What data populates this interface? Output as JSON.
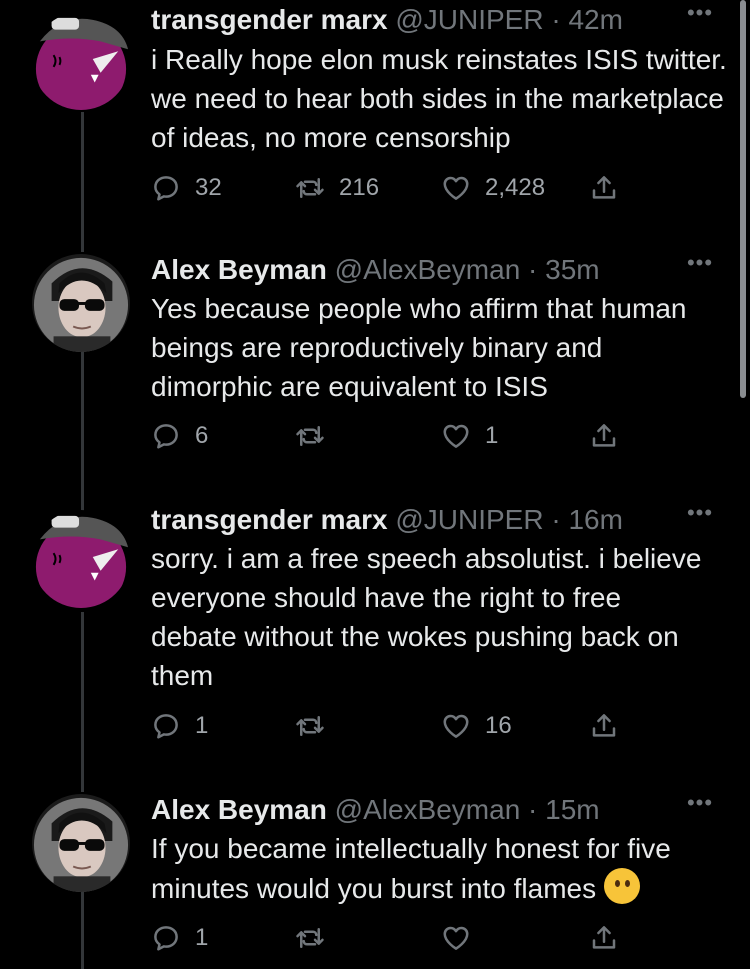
{
  "tweets": [
    {
      "display_name": "transgender marx",
      "handle": "@JUNIPER",
      "separator": "·",
      "time": "42m",
      "more": "•••",
      "text": "i Really hope elon musk reinstates ISIS twitter.  we need to hear both sides in the marketplace of ideas, no more censorship",
      "replies": "32",
      "retweets": "216",
      "likes": "2,428",
      "avatar": "pink-cat-avatar"
    },
    {
      "display_name": "Alex Beyman",
      "handle": "@AlexBeyman",
      "separator": "·",
      "time": "35m",
      "more": "•••",
      "text": "Yes because people who affirm that human beings are reproductively binary and dimorphic are equivalent to ISIS",
      "replies": "6",
      "retweets": "",
      "likes": "1",
      "avatar": "man-sunglasses-avatar"
    },
    {
      "display_name": "transgender marx",
      "handle": "@JUNIPER",
      "separator": "·",
      "time": "16m",
      "more": "•••",
      "text": "sorry.  i am a free speech absolutist.  i believe everyone should have the right to free debate without the wokes pushing back on them",
      "replies": "1",
      "retweets": "",
      "likes": "16",
      "avatar": "pink-cat-avatar"
    },
    {
      "display_name": "Alex Beyman",
      "handle": "@AlexBeyman",
      "separator": "·",
      "time": "15m",
      "more": "•••",
      "text": "If you became intellectually honest for five minutes would you burst into flames",
      "replies": "1",
      "retweets": "",
      "likes": "",
      "avatar": "man-sunglasses-avatar"
    }
  ],
  "colors": {
    "background": "#000000",
    "text": "#e7e9ea",
    "muted": "#71767b",
    "thread_line": "#333639",
    "avatar_pink": "#8e1b6e"
  },
  "icons": [
    "reply-icon",
    "retweet-icon",
    "like-icon",
    "share-icon",
    "thinking-face-emoji"
  ]
}
